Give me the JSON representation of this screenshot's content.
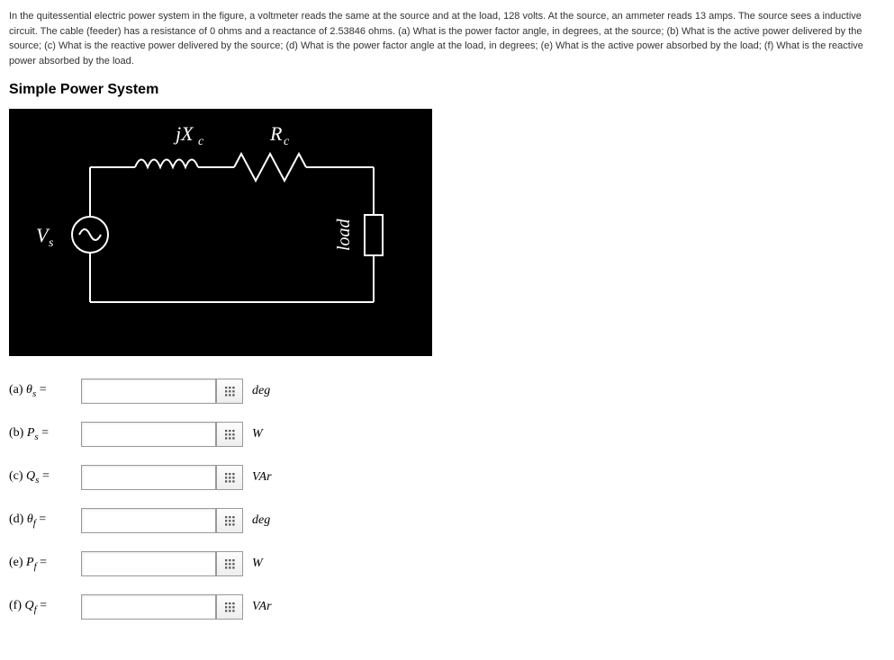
{
  "problem": {
    "text": "In the quitessential electric power system in the figure, a voltmeter reads the same at the source and at the load, 128 volts. At the source, an ammeter reads 13 amps. The source sees a inductive circuit. The cable (feeder) has a resistance of 0 ohms and a reactance of 2.53846 ohms. (a) What is the power factor angle, in degrees, at the source; (b) What is the active power delivered by the source; (c) What is the reactive power delivered by the source; (d) What is the power factor angle at the load, in degrees; (e) What is the active power absorbed by the load; (f) What is the reactive power absorbed by the load."
  },
  "title": "Simple Power System",
  "diagram": {
    "jxc_label": "jX",
    "jxc_sub": "c",
    "rc_label": "R",
    "rc_sub": "c",
    "vs_label": "V",
    "vs_sub": "s",
    "load_label": "load"
  },
  "answers": [
    {
      "label_prefix": "(a) ",
      "var": "θ",
      "sub": "s",
      "unit": "deg",
      "value": ""
    },
    {
      "label_prefix": "(b) ",
      "var": "P",
      "sub": "s",
      "unit": "W",
      "value": ""
    },
    {
      "label_prefix": "(c) ",
      "var": "Q",
      "sub": "s",
      "unit": "VAr",
      "value": ""
    },
    {
      "label_prefix": "(d) ",
      "var": "θ",
      "sub": "f",
      "unit": "deg",
      "value": ""
    },
    {
      "label_prefix": "(e) ",
      "var": "P",
      "sub": "f",
      "unit": "W",
      "value": ""
    },
    {
      "label_prefix": "(f) ",
      "var": "Q",
      "sub": "f",
      "unit": "VAr",
      "value": ""
    }
  ]
}
